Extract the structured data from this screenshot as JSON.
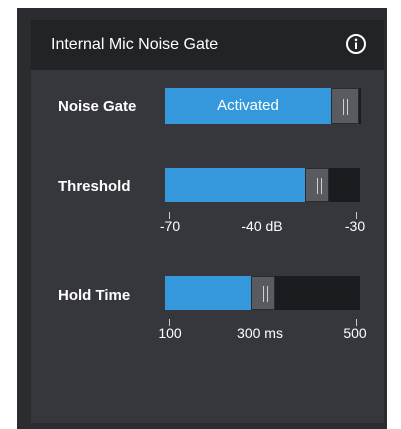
{
  "header": {
    "title": "Internal Mic Noise Gate",
    "info_icon": "info-icon"
  },
  "noise_gate": {
    "label": "Noise Gate",
    "state": "Activated"
  },
  "threshold": {
    "label": "Threshold",
    "min_label": "-70",
    "value_label": "-40 dB",
    "max_label": "-30",
    "fill_fraction": 0.78
  },
  "hold_time": {
    "label": "Hold Time",
    "min_label": "100",
    "value_label": "300 ms",
    "max_label": "500",
    "fill_fraction": 0.5
  },
  "colors": {
    "accent": "#3598dc",
    "panel": "#36373c",
    "header": "#222326",
    "track": "#1b1c1f"
  }
}
